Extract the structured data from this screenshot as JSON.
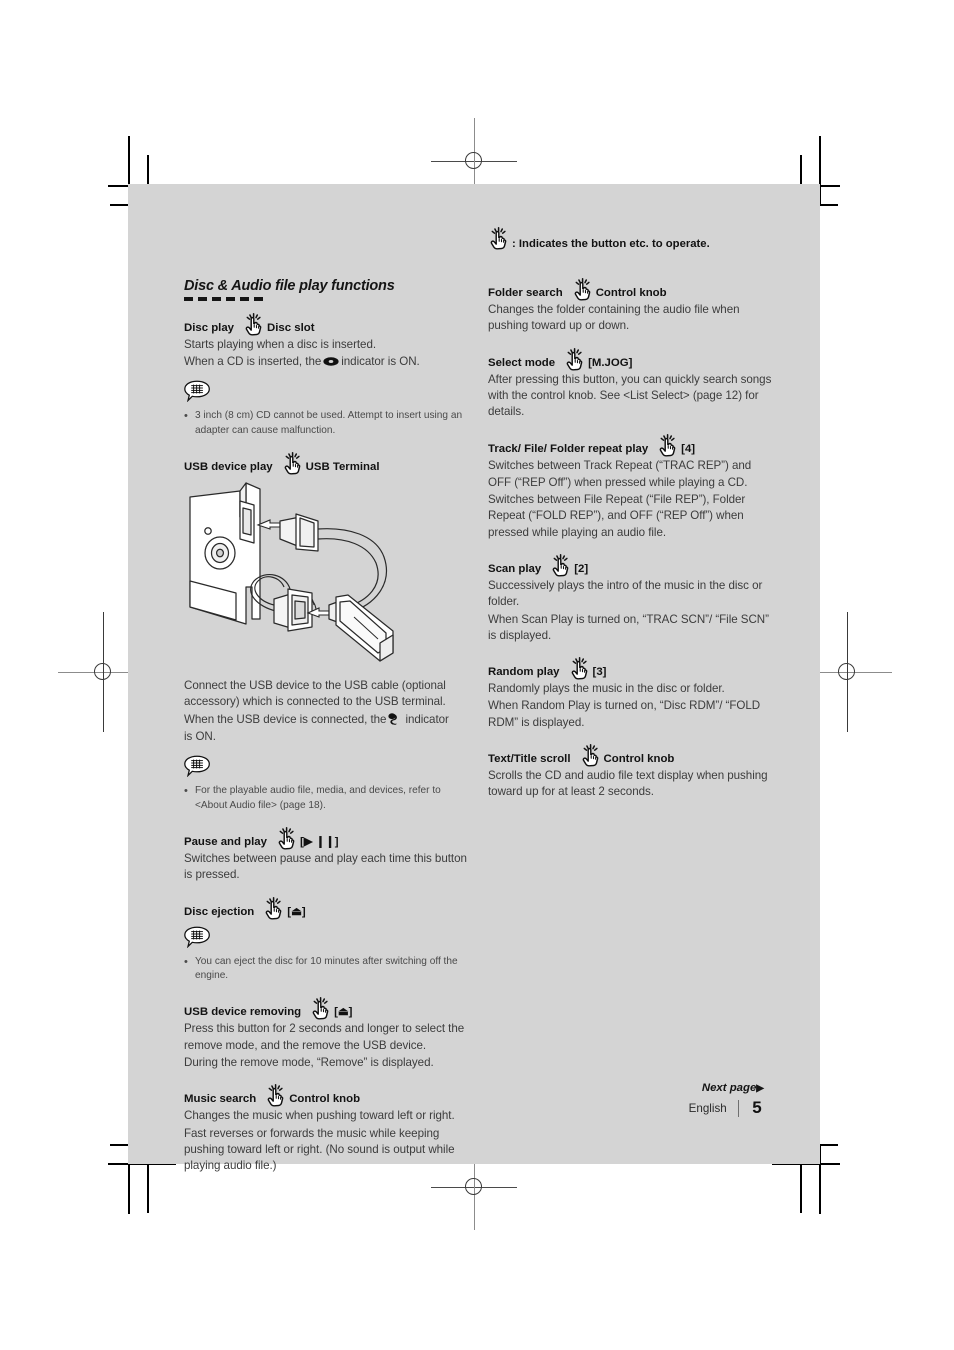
{
  "legend": {
    "icon": "pointing-hand-icon",
    "text": ": Indicates the button etc. to operate."
  },
  "section": {
    "title": "Disc & Audio file play functions"
  },
  "left_column": [
    {
      "type": "entry",
      "label": "Disc play",
      "target": "Disc slot",
      "body": [
        "Starts playing when a disc is inserted.",
        "When a CD is inserted, the @DISC@ indicator is ON."
      ]
    },
    {
      "type": "note",
      "bullets": [
        "3 inch (8 cm) CD cannot be used. Attempt to insert using an adapter can cause malfunction."
      ]
    },
    {
      "type": "entry",
      "label": "USB device play",
      "target": "USB Terminal",
      "figure": "usb-connection-diagram",
      "body": [
        "Connect the USB device to the USB cable (optional accessory) which is connected to the USB terminal.",
        "When the USB device is connected, the @USB@ indicator is ON."
      ]
    },
    {
      "type": "note",
      "bullets": [
        "For the playable audio file, media, and devices, refer to <About Audio file> (page 18)."
      ]
    },
    {
      "type": "entry",
      "label": "Pause and play",
      "target": "[▶ ❙❙]",
      "body": [
        "Switches between pause and play each time this button is pressed."
      ]
    },
    {
      "type": "entry",
      "label": "Disc ejection",
      "target": "[⏏]",
      "body": []
    },
    {
      "type": "note",
      "bullets": [
        "You can eject the disc for 10 minutes after switching off the engine."
      ]
    },
    {
      "type": "entry",
      "label": "USB device removing",
      "target": "[⏏]",
      "body": [
        "Press this button for 2 seconds and longer to select the remove mode, and the remove the USB device.",
        "During the remove mode, “Remove” is displayed."
      ]
    },
    {
      "type": "entry",
      "label": "Music search",
      "target": "Control knob",
      "body": [
        "Changes the music when pushing toward left or right.",
        "Fast reverses or forwards the music while keeping pushing toward left or right. (No sound is output while playing audio file.)"
      ]
    }
  ],
  "right_column": [
    {
      "type": "entry",
      "label": "Folder search",
      "target": "Control knob",
      "body": [
        "Changes the folder containing the audio file when pushing toward up or down."
      ]
    },
    {
      "type": "entry",
      "label": "Select mode",
      "target": "[M.JOG]",
      "body": [
        "After pressing this button, you can quickly search songs with the control knob. See <List Select> (page 12) for details."
      ]
    },
    {
      "type": "entry",
      "label": "Track/ File/ Folder repeat play",
      "target": "[4]",
      "body": [
        "Switches between Track Repeat (“TRAC REP”) and OFF (“REP Off”) when pressed while playing a CD.",
        "Switches between File Repeat (“File REP”), Folder Repeat (“FOLD REP”), and OFF (“REP Off”) when pressed while playing an audio file."
      ]
    },
    {
      "type": "entry",
      "label": "Scan play",
      "target": "[2]",
      "body": [
        "Successively plays the intro of the music in the disc or folder.",
        "When Scan Play is turned on, “TRAC SCN”/ “File SCN” is displayed."
      ]
    },
    {
      "type": "entry",
      "label": "Random play",
      "target": "[3]",
      "body": [
        "Randomly plays the music in the disc or folder.",
        "When Random Play is turned on, “Disc RDM”/ “FOLD RDM” is displayed."
      ]
    },
    {
      "type": "entry",
      "label": "Text/Title scroll",
      "target": "Control knob",
      "body": [
        "Scrolls the CD and audio file text display when pushing toward up for at least 2 seconds."
      ]
    }
  ],
  "footer": {
    "next_page": "Next page",
    "next_arrow": "▶",
    "language": "English",
    "page_number": "5"
  },
  "colors": {
    "page_background": "#d4d4d4",
    "paper": "#ffffff",
    "heading_text": "#121212",
    "body_text": "#3c3c3c",
    "note_text": "#4a4a4a"
  }
}
